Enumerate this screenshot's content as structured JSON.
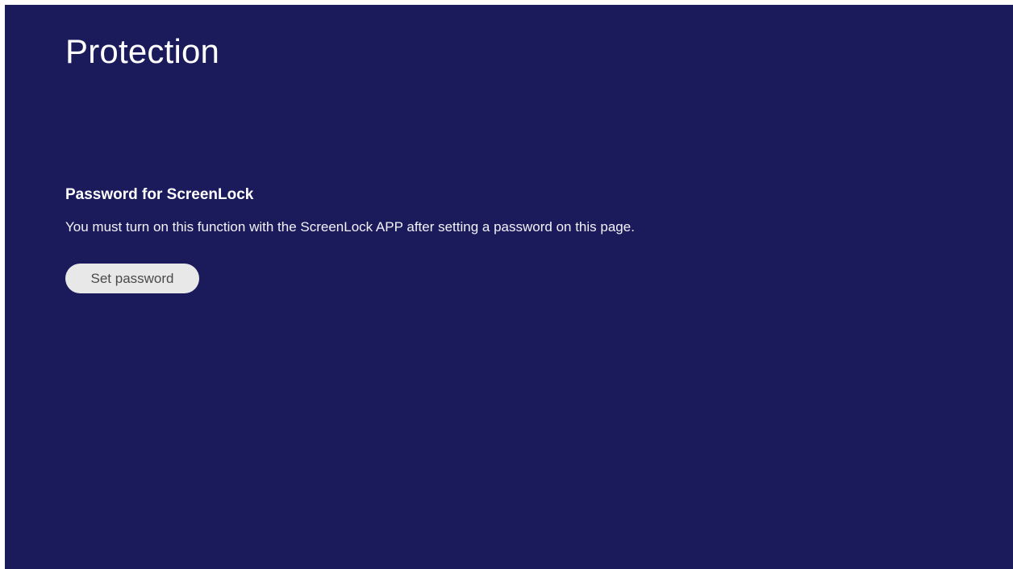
{
  "page": {
    "title": "Protection"
  },
  "screenlock": {
    "heading": "Password for ScreenLock",
    "description": "You must turn on this function with the ScreenLock APP after setting a password on this page.",
    "set_password_label": "Set password"
  },
  "colors": {
    "background": "#1b1b5c",
    "button_bg": "#e8e8e8",
    "button_text": "#4a4a4a",
    "text": "#ffffff"
  }
}
